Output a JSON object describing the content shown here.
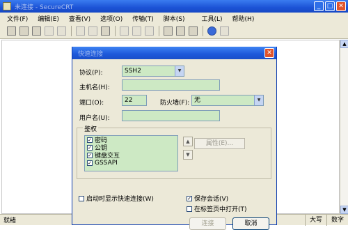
{
  "window": {
    "title": "未连接 - SecureCRT"
  },
  "menu": [
    "文件(F)",
    "编辑(E)",
    "查看(V)",
    "选项(O)",
    "传输(T)",
    "脚本(S)",
    "工具(L)",
    "帮助(H)"
  ],
  "toolbar": {
    "icons": [
      "connect-icon",
      "quick-connect-icon",
      "connect-tab-icon",
      "reconnect-icon",
      "disconnect-icon",
      "copy-icon",
      "paste-icon",
      "find-icon",
      "print-icon",
      "print-setup-icon",
      "log-icon",
      "session-options-icon",
      "global-options-icon",
      "keymap-icon",
      "help-icon",
      "sftp-icon"
    ]
  },
  "status": {
    "left": "就绪",
    "caps": "大写",
    "num": "数字"
  },
  "dialog": {
    "title": "快速连接",
    "protocol_label": "协议(P):",
    "protocol_value": "SSH2",
    "hostname_label": "主机名(H):",
    "hostname_value": "",
    "port_label": "端口(O):",
    "port_value": "22",
    "firewall_label": "防火墙(F):",
    "firewall_value": "无",
    "username_label": "用户名(U):",
    "username_value": "",
    "auth_group": "鉴权",
    "auth_items": [
      {
        "label": "密码",
        "checked": true
      },
      {
        "label": "公钥",
        "checked": true
      },
      {
        "label": "键盘交互",
        "checked": true
      },
      {
        "label": "GSSAPI",
        "checked": true
      }
    ],
    "properties_button": "属性(E)...",
    "show_on_startup": "启动时显示快速连接(W)",
    "save_session": "保存会话(V)",
    "open_in_tab": "在标签页中打开(T)",
    "connect_button": "连接",
    "cancel_button": "取消"
  }
}
